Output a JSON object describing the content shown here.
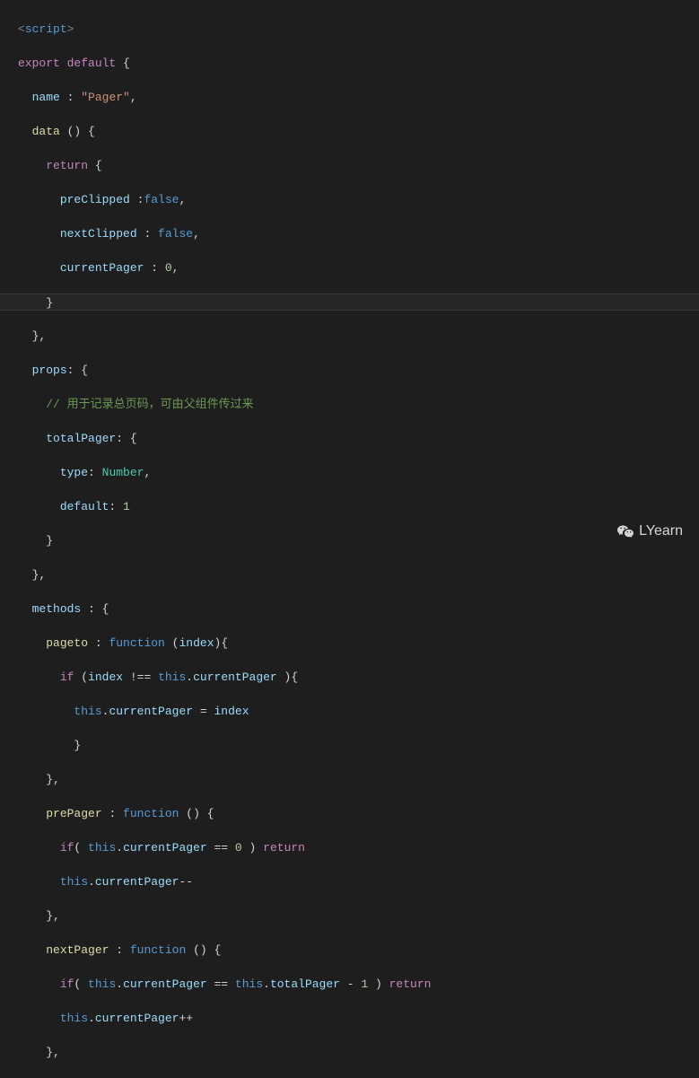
{
  "code": {
    "tag_open_lt": "<",
    "tag_open_gt": ">",
    "tag_name": "script",
    "kw_export": "export",
    "kw_default": "default",
    "sp": " ",
    "brace_open": "{",
    "brace_close": "}",
    "indent1": "  ",
    "indent2": "    ",
    "indent3": "      ",
    "indent4": "        ",
    "prop_name": "name",
    "colon_sp": " : ",
    "colon": ": ",
    "str_pager": "\"Pager\"",
    "comma": ",",
    "prop_data": "data",
    "parens": " () ",
    "kw_return": "return",
    "prop_preClipped": "preClipped",
    "colon_tight": " :",
    "val_false": "false",
    "prop_nextClipped": "nextClipped",
    "prop_currentPager": "currentPager",
    "val_zero": "0",
    "prop_props": "props",
    "comment_cn": "// 用于记录总页码，可由父组件传过来",
    "prop_totalPager": "totalPager",
    "prop_type": "type",
    "val_number": "Number",
    "prop_default": "default",
    "val_one": "1",
    "prop_methods": "methods",
    "fn_pageto": "pageto",
    "kw_function": "function",
    "paren_open": "(",
    "paren_close": ")",
    "param_index": "index",
    "kw_if": "if",
    "op_neq": " !== ",
    "kw_this": "this",
    "dot": ".",
    "op_assign": " = ",
    "fn_prePager": "prePager",
    "op_eq": " == ",
    "kw_return2": "return",
    "op_decr": "--",
    "fn_nextPager": "nextPager",
    "op_minus": " - ",
    "op_incr": "++"
  },
  "watermark": {
    "text": "LYearn"
  }
}
